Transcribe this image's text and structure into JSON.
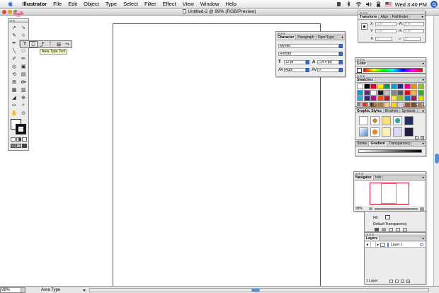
{
  "menubar": {
    "app_name": "Illustrator",
    "items": [
      "File",
      "Edit",
      "Object",
      "Type",
      "Select",
      "Filter",
      "Effect",
      "View",
      "Window",
      "Help"
    ],
    "clock": "Wed 3:40 PM"
  },
  "document": {
    "title": "Untitled-2 @ 99% (RGB/Preview)",
    "zoom": "99%",
    "status_tool": "Area Type"
  },
  "toolbox": {
    "tooltip": "Area Type Tool",
    "tools": [
      "➚",
      "➘",
      "✎",
      "⊹",
      "✒",
      "T",
      "╲",
      "□",
      "✐",
      "✏",
      "◎",
      "▣",
      "⟲",
      "▤",
      "⊞",
      "⟴",
      "▦",
      "▥",
      "◢",
      "⊕",
      "✂",
      "⌕",
      "✋",
      "⊙"
    ]
  },
  "character_panel": {
    "tabs": [
      "Character",
      "Paragraph",
      "OpenType"
    ],
    "font_family": "Myriad",
    "font_style": "Roman",
    "size": "12 pt",
    "leading": "(14.4 pt)",
    "kerning": "Auto",
    "tracking": "0"
  },
  "transform_panel": {
    "tabs": [
      "Transform",
      "Align",
      "Pathfinder"
    ],
    "x_label": "X:",
    "x_value": "0 in",
    "y_label": "Y:",
    "y_value": "0 in",
    "w_label": "W:",
    "w_value": "0 in",
    "h_label": "H:",
    "h_value": "0 in",
    "rotate": "0°",
    "shear": "0°"
  },
  "color_panel": {
    "tabs": [
      "Color"
    ]
  },
  "swatches_panel": {
    "tabs": [
      "Swatches"
    ],
    "swatch_colors": [
      "#ffffff",
      "#000000",
      "#e2001a",
      "#f6e600",
      "#00963f",
      "#00a0e0",
      "#2b2a82",
      "#e4007c",
      "#f39200",
      "#95c11f",
      "#009fe3",
      "#662483",
      "#ffffff",
      "#1d1d1b",
      "#c3c3c3",
      "#878787",
      "#575756",
      "#e30613",
      "#f9b233",
      "#3aaa35",
      "#36a9e1",
      "#312783",
      "#951b81",
      "#e94e1b",
      "#be1622",
      "#fcea10",
      "#93c01f",
      "#1d71b8",
      "#a3195b",
      "#dedc00",
      "#c0c0c0",
      "#b17f4a",
      "#7d4e24",
      "#aa7c3f",
      "#f5c98f",
      "#ffd700",
      "#d3d3d3",
      "#a0522d",
      "#8b4513",
      "#cd853f"
    ]
  },
  "graphic_styles_panel": {
    "tabs": [
      "Graphic Styles",
      "Brushes",
      "Symbols"
    ]
  },
  "stroke_panel": {
    "tabs": [
      "Stroke",
      "Gradient",
      "Transparency"
    ]
  },
  "navigator_panel": {
    "tabs": [
      "Navigator",
      "Info"
    ],
    "zoom": "99%"
  },
  "appearance_panel": {
    "fill_label": "Fill:",
    "default_transparency": "Default Transparency"
  },
  "layers_panel": {
    "tabs": [
      "Layers"
    ],
    "layer_name": "Layer 1",
    "layer_count": "1 Layer"
  }
}
